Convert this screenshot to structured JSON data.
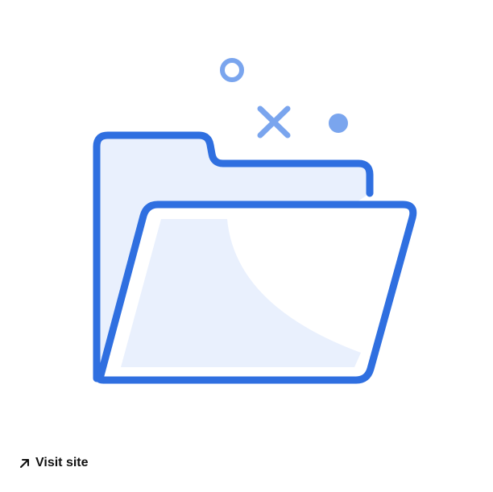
{
  "illustration": {
    "icon": "open-folder-icon",
    "decorations": [
      "ring-icon",
      "x-mark-icon",
      "dot-icon"
    ],
    "colors": {
      "stroke": "#2f6fe0",
      "fill": "#e9f0fd",
      "accent": "#7aa5ee",
      "background": "#ffffff"
    }
  },
  "link": {
    "icon": "external-arrow-icon",
    "label": "Visit site"
  }
}
